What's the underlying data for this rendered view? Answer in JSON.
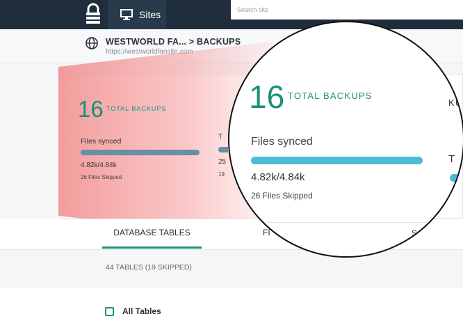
{
  "header": {
    "nav_sites_label": "Sites",
    "search_placeholder": "Search site"
  },
  "breadcrumb": {
    "path": "WESTWORLD FA... > BACKUPS",
    "url": "https://westworldfansite.com"
  },
  "backups": {
    "total_count": "16",
    "total_label": "TOTAL BACKUPS",
    "files_label": "Files synced",
    "files_value": "4.82k/4.84k",
    "files_skipped": "26 Files Skipped",
    "files_progress": 0.996,
    "tables_label_partial": "T",
    "tables_value_partial": "25",
    "tables_skipped_partial": "19",
    "second_label_partial": "KUP"
  },
  "tabs": [
    {
      "label": "DATABASE TABLES",
      "active": true
    },
    {
      "label": "FI",
      "active": false
    },
    {
      "label": "S",
      "active": false
    }
  ],
  "tables_summary": "44 TABLES (19 SKIPPED)",
  "all_tables_label": "All Tables",
  "colors": {
    "accent": "#1a9079",
    "topbar": "#1f2d3d",
    "progress": "#4bbcd6",
    "highlight": "#f08a8a"
  }
}
